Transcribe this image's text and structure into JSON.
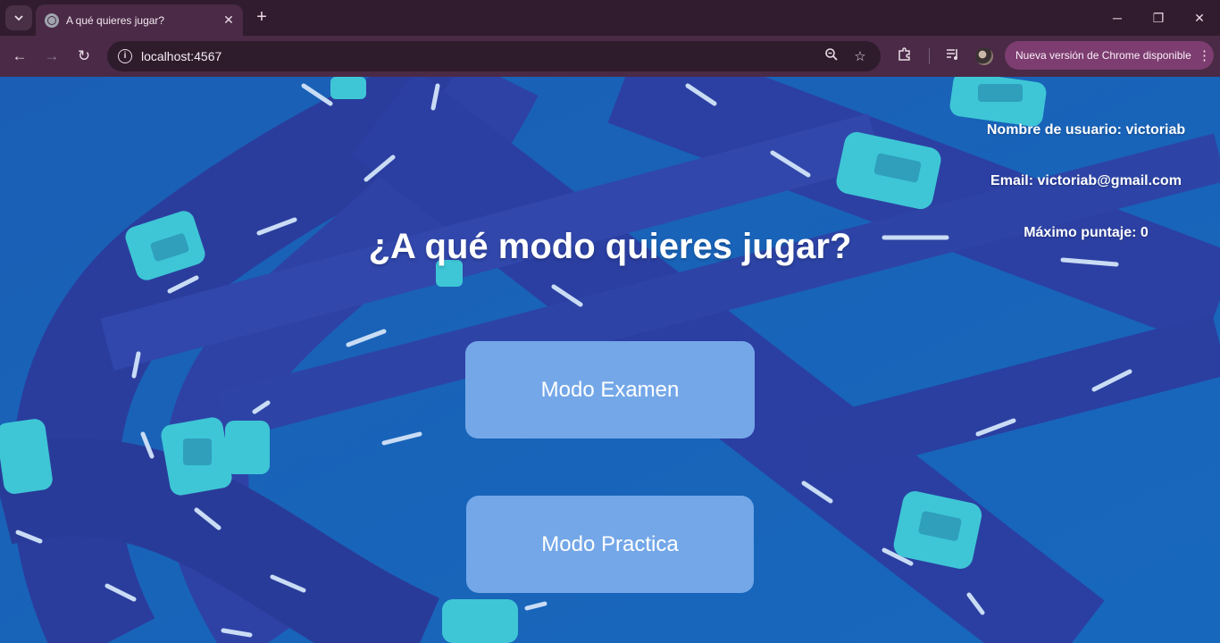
{
  "browser": {
    "tab": {
      "title": "A qué quieres jugar?",
      "close_glyph": "✕",
      "favicon": "globe-icon"
    },
    "new_tab_glyph": "+",
    "window_controls": {
      "minimize": "─",
      "maximize": "❐",
      "close": "✕"
    },
    "nav": {
      "back": "←",
      "forward": "→",
      "reload": "↻"
    },
    "address": {
      "url": "localhost:4567",
      "info_glyph": "i"
    },
    "omnibox_icons": {
      "zoom": "🔍",
      "bookmark": "☆"
    },
    "toolbar_icons": {
      "extensions": "⧉",
      "media": "≡"
    },
    "update": {
      "label": "Nueva versión de Chrome disponible",
      "menu": "⋮"
    }
  },
  "user": {
    "username_line": "Nombre de usuario: victoriab",
    "email_line": "Email: victoriab@gmail.com",
    "score_line": "Máximo puntaje: 0"
  },
  "main": {
    "heading": "¿A qué modo quieres jugar?",
    "buttons": {
      "exam": "Modo Examen",
      "practice": "Modo Practica"
    }
  },
  "colors": {
    "background": "#1763b8",
    "road": "#2c3fa0",
    "car": "#3ec6d6",
    "button": "#74a7e8"
  }
}
